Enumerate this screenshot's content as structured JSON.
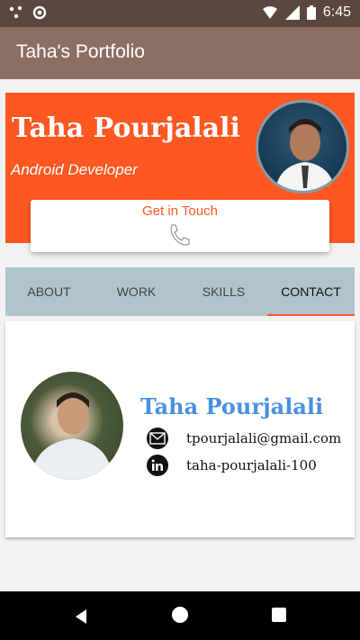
{
  "status_bar": {
    "time": "6:45",
    "left_icons": [
      "share-icon",
      "sync-icon"
    ],
    "right_icons": [
      "wifi-icon",
      "signal-icon",
      "battery-icon"
    ]
  },
  "app_bar": {
    "title": "Taha's Portfolio"
  },
  "header": {
    "name": "Taha Pourjalali",
    "role": "Android Developer",
    "background_color": "#ff5722"
  },
  "contact_card": {
    "label": "Get in Touch",
    "icon": "phone-icon",
    "accent_color": "#ff5722"
  },
  "tabs": [
    {
      "label": "ABOUT",
      "active": false
    },
    {
      "label": "WORK",
      "active": false
    },
    {
      "label": "SKILLS",
      "active": false
    },
    {
      "label": "CONTACT",
      "active": true
    }
  ],
  "contact_content": {
    "name": "Taha Pourjalali",
    "name_color": "#4a90e2",
    "email": "tpourjalali@gmail.com",
    "linkedin": "taha-pourjalali-100",
    "email_icon": "envelope-icon",
    "linkedin_icon": "linkedin-icon"
  },
  "nav_bar": {
    "buttons": [
      "back-button",
      "home-button",
      "recents-button"
    ]
  }
}
